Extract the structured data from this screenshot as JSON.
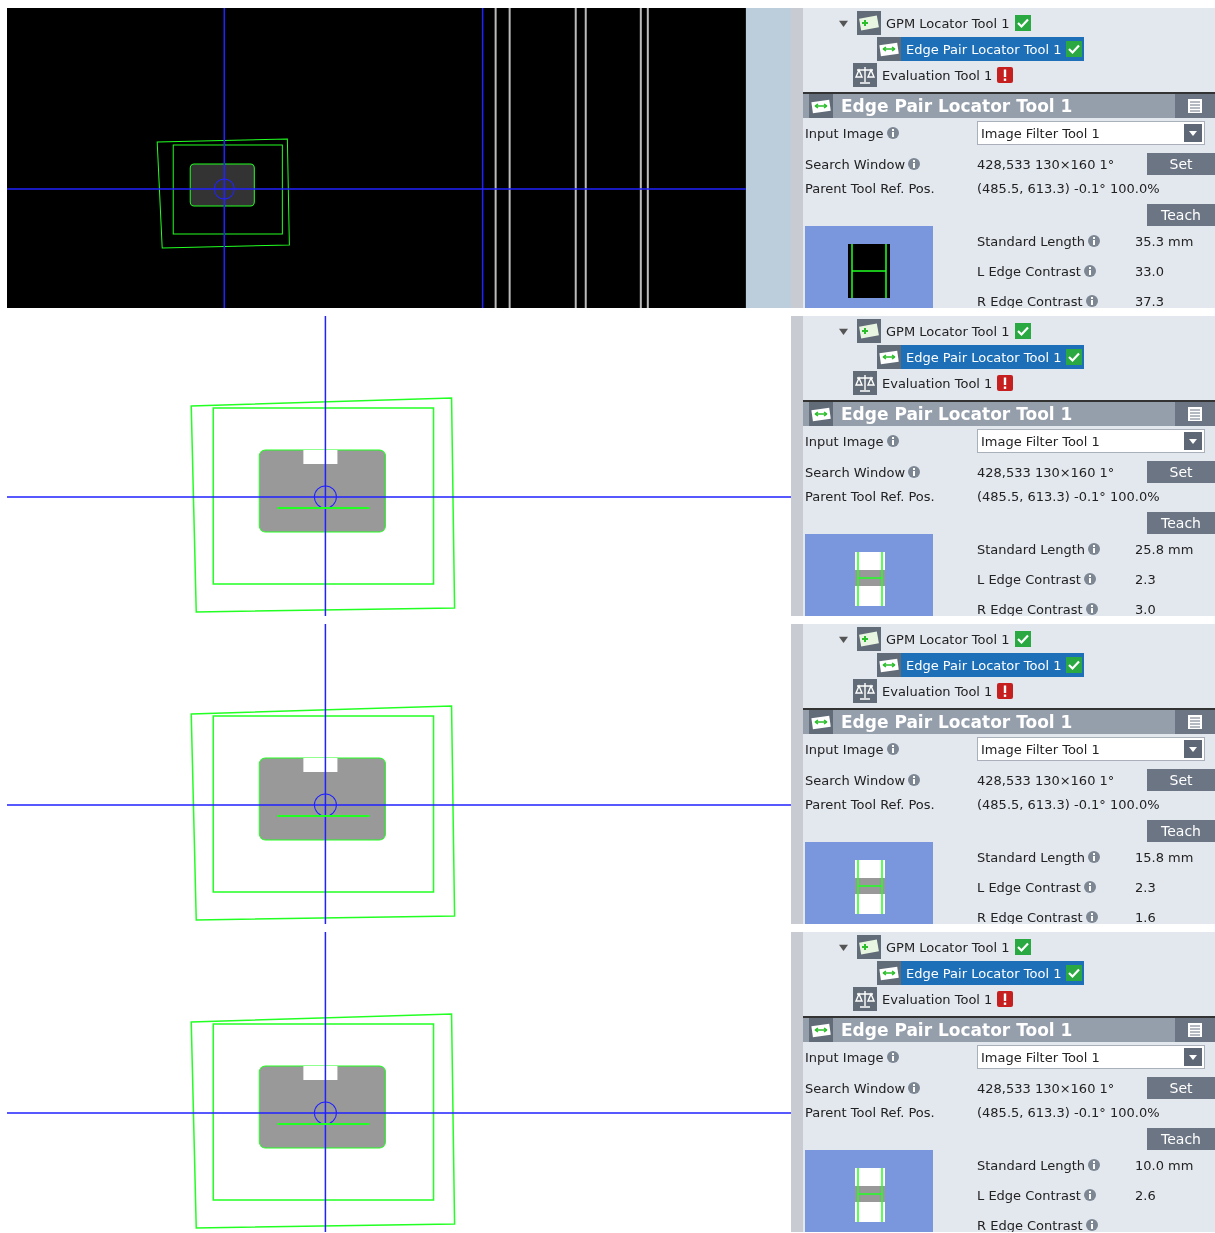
{
  "strips": [
    {
      "view": {
        "kind": "dark"
      },
      "tree": [
        {
          "label": "GPM Locator Tool 1",
          "kind": "locator",
          "passed": true,
          "expanded": true,
          "selected": false,
          "children": [
            {
              "label": "Edge Pair Locator Tool 1",
              "kind": "edge",
              "passed": true,
              "selected": true
            }
          ]
        },
        {
          "label": "Evaluation Tool 1",
          "kind": "evaluation",
          "passed": false,
          "selected": false
        }
      ],
      "panel": {
        "title": "Edge Pair Locator Tool 1",
        "input_image": {
          "label": "Input Image",
          "value": "Image Filter Tool 1"
        },
        "search_window": {
          "label": "Search Window",
          "value": "428,533 130×160 1°",
          "button": "Set"
        },
        "parent_ref": {
          "label": "Parent Tool Ref. Pos.",
          "value": "(485.5, 613.3) -0.1° 100.0%"
        },
        "teach_button": "Teach",
        "thumbnail": {
          "kind": "dark"
        },
        "params": [
          {
            "label": "Standard Length",
            "value": "35.3 mm"
          },
          {
            "label": "L Edge Contrast",
            "value": "33.0"
          },
          {
            "label": "R Edge Contrast",
            "value": "37.3"
          }
        ]
      }
    },
    {
      "view": {
        "kind": "light"
      },
      "tree": [
        {
          "label": "GPM Locator Tool 1",
          "kind": "locator",
          "passed": true,
          "expanded": true,
          "selected": false,
          "children": [
            {
              "label": "Edge Pair Locator Tool 1",
              "kind": "edge",
              "passed": true,
              "selected": true
            }
          ]
        },
        {
          "label": "Evaluation Tool 1",
          "kind": "evaluation",
          "passed": false,
          "selected": false
        }
      ],
      "panel": {
        "title": "Edge Pair Locator Tool 1",
        "input_image": {
          "label": "Input Image",
          "value": "Image Filter Tool 1"
        },
        "search_window": {
          "label": "Search Window",
          "value": "428,533 130×160 1°",
          "button": "Set"
        },
        "parent_ref": {
          "label": "Parent Tool Ref. Pos.",
          "value": "(485.5, 613.3) -0.1° 100.0%"
        },
        "teach_button": "Teach",
        "thumbnail": {
          "kind": "light"
        },
        "params": [
          {
            "label": "Standard Length",
            "value": "25.8 mm"
          },
          {
            "label": "L Edge Contrast",
            "value": "2.3"
          },
          {
            "label": "R Edge Contrast",
            "value": "3.0"
          }
        ]
      }
    },
    {
      "view": {
        "kind": "light"
      },
      "tree": [
        {
          "label": "GPM Locator Tool 1",
          "kind": "locator",
          "passed": true,
          "expanded": true,
          "selected": false,
          "children": [
            {
              "label": "Edge Pair Locator Tool 1",
              "kind": "edge",
              "passed": true,
              "selected": true
            }
          ]
        },
        {
          "label": "Evaluation Tool 1",
          "kind": "evaluation",
          "passed": false,
          "selected": false
        }
      ],
      "panel": {
        "title": "Edge Pair Locator Tool 1",
        "input_image": {
          "label": "Input Image",
          "value": "Image Filter Tool 1"
        },
        "search_window": {
          "label": "Search Window",
          "value": "428,533 130×160 1°",
          "button": "Set"
        },
        "parent_ref": {
          "label": "Parent Tool Ref. Pos.",
          "value": "(485.5, 613.3) -0.1° 100.0%"
        },
        "teach_button": "Teach",
        "thumbnail": {
          "kind": "light"
        },
        "params": [
          {
            "label": "Standard Length",
            "value": "15.8 mm"
          },
          {
            "label": "L Edge Contrast",
            "value": "2.3"
          },
          {
            "label": "R Edge Contrast",
            "value": "1.6"
          }
        ]
      }
    },
    {
      "view": {
        "kind": "light"
      },
      "tree": [
        {
          "label": "GPM Locator Tool 1",
          "kind": "locator",
          "passed": true,
          "expanded": true,
          "selected": false,
          "children": [
            {
              "label": "Edge Pair Locator Tool 1",
              "kind": "edge",
              "passed": true,
              "selected": true
            }
          ]
        },
        {
          "label": "Evaluation Tool 1",
          "kind": "evaluation",
          "passed": false,
          "selected": false
        }
      ],
      "panel": {
        "title": "Edge Pair Locator Tool 1",
        "input_image": {
          "label": "Input Image",
          "value": "Image Filter Tool 1"
        },
        "search_window": {
          "label": "Search Window",
          "value": "428,533 130×160 1°",
          "button": "Set"
        },
        "parent_ref": {
          "label": "Parent Tool Ref. Pos.",
          "value": "(485.5, 613.3) -0.1° 100.0%"
        },
        "teach_button": "Teach",
        "thumbnail": {
          "kind": "light"
        },
        "params": [
          {
            "label": "Standard Length",
            "value": "10.0 mm"
          },
          {
            "label": "L Edge Contrast",
            "value": "2.6"
          },
          {
            "label": "R Edge Contrast"
          }
        ]
      }
    }
  ]
}
